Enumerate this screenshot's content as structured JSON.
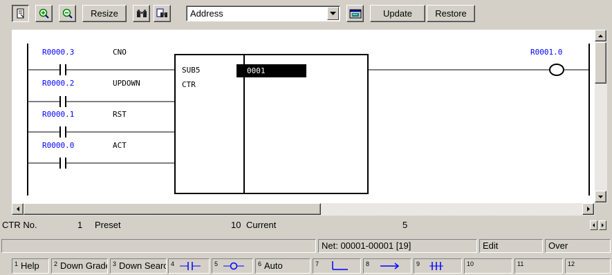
{
  "toolbar": {
    "resize_label": "Resize",
    "address_value": "Address",
    "update_label": "Update",
    "restore_label": "Restore"
  },
  "icons": {
    "new_window": "window-icon",
    "zoom_in": "zoom-in-icon",
    "zoom_out": "zoom-out-icon",
    "search": "binoculars-icon",
    "search_replace": "find-replace-icon",
    "address_lookup": "address-icon"
  },
  "ladder": {
    "contacts": [
      {
        "address": "R0000.3",
        "name": "CNO"
      },
      {
        "address": "R0000.2",
        "name": "UPDOWN"
      },
      {
        "address": "R0000.1",
        "name": "RST"
      },
      {
        "address": "R0000.0",
        "name": "ACT"
      }
    ],
    "function_block": {
      "sub_label": "SUB5",
      "name": "CTR",
      "param_value": "0001"
    },
    "coil": {
      "address": "R0001.0"
    },
    "colors": {
      "address": "#0000ff",
      "wire": "#000000",
      "highlight": "#000000"
    }
  },
  "info": {
    "ctr_label": "CTR No.",
    "ctr_value": "1",
    "preset_label": "Preset",
    "preset_value": "10",
    "current_label": "Current",
    "current_value": "5"
  },
  "status": {
    "net": "Net: 00001-00001 [19]",
    "mode": "Edit",
    "insert": "Over"
  },
  "fkeys": [
    {
      "num": "1",
      "label": "Help"
    },
    {
      "num": "2",
      "label": "Down Grade"
    },
    {
      "num": "3",
      "label": "Down Search"
    },
    {
      "num": "4",
      "label": "",
      "icon": "contact-no-icon"
    },
    {
      "num": "5",
      "label": "",
      "icon": "coil-icon"
    },
    {
      "num": "6",
      "label": "Auto"
    },
    {
      "num": "7",
      "label": "",
      "icon": "branch-icon"
    },
    {
      "num": "8",
      "label": "",
      "icon": "arrow-right-icon"
    },
    {
      "num": "9",
      "label": "",
      "icon": "vertical-line-icon"
    },
    {
      "num": "10",
      "label": ""
    },
    {
      "num": "11",
      "label": ""
    },
    {
      "num": "12",
      "label": ""
    }
  ]
}
